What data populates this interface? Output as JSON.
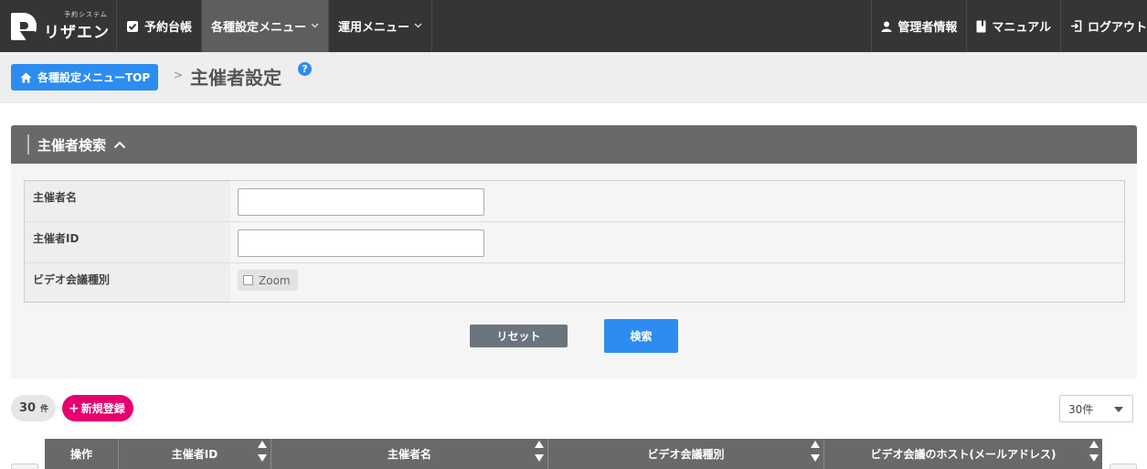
{
  "app": {
    "logo_small": "予約システム",
    "logo_big": "リザエン"
  },
  "nav": {
    "items": [
      {
        "label": "予約台帳",
        "icon": "check-square-icon"
      },
      {
        "label": "各種設定メニュー",
        "icon": "chevron-down-icon",
        "active": true
      },
      {
        "label": "運用メニュー",
        "icon": "chevron-down-icon"
      }
    ],
    "right": [
      {
        "label": "管理者情報",
        "icon": "user-icon"
      },
      {
        "label": "マニュアル",
        "icon": "book-icon"
      },
      {
        "label": "ログアウト",
        "icon": "logout-icon"
      }
    ]
  },
  "breadcrumb": {
    "home_label": "各種設定メニューTOP",
    "separator": ">",
    "title": "主催者設定",
    "help": "?"
  },
  "search": {
    "title": "主催者検索",
    "fields": {
      "organizer_name": {
        "label": "主催者名",
        "value": ""
      },
      "organizer_id": {
        "label": "主催者ID",
        "value": ""
      },
      "video_type": {
        "label": "ビデオ会議種別",
        "option": "Zoom",
        "checked": false
      }
    },
    "reset_label": "リセット",
    "search_label": "検索"
  },
  "results": {
    "count": "30",
    "count_unit": "件",
    "new_label": "新規登録",
    "per_page": "30件",
    "columns": [
      "操作",
      "主催者ID",
      "主催者名",
      "ビデオ会議種別",
      "ビデオ会議のホスト(メールアドレス)"
    ]
  },
  "colors": {
    "nav_bg": "#353535",
    "accent_blue": "#2d8cf0",
    "accent_pink": "#e6006e",
    "panel_head": "#696969"
  }
}
